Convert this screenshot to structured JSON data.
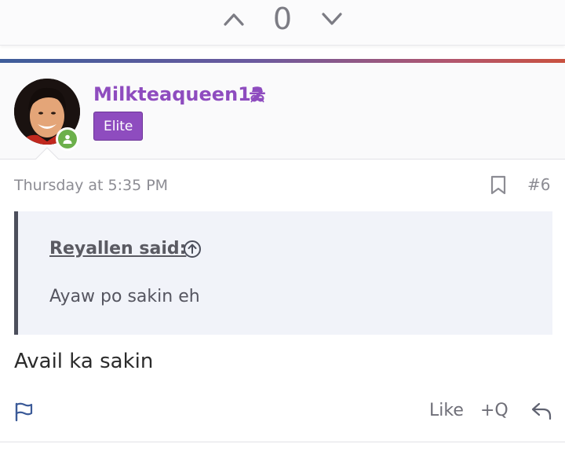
{
  "vote": {
    "count": "0",
    "up_icon": "chevron-up-icon",
    "down_icon": "chevron-down-icon"
  },
  "user": {
    "name": "Milkteaqueen12",
    "rank_badge": "Elite",
    "status": "online",
    "name_color": "#8e4cbf"
  },
  "post": {
    "timestamp": "Thursday at 5:35 PM",
    "number": "#6",
    "quote": {
      "author": "Reyallen said:",
      "text": "Ayaw po sakin eh"
    },
    "body": "Avail ka sakin"
  },
  "actions": {
    "like_label": "Like",
    "quote_label": "+Q",
    "report_icon": "flag-icon",
    "reply_icon": "reply-icon",
    "bookmark_icon": "bookmark-icon"
  }
}
